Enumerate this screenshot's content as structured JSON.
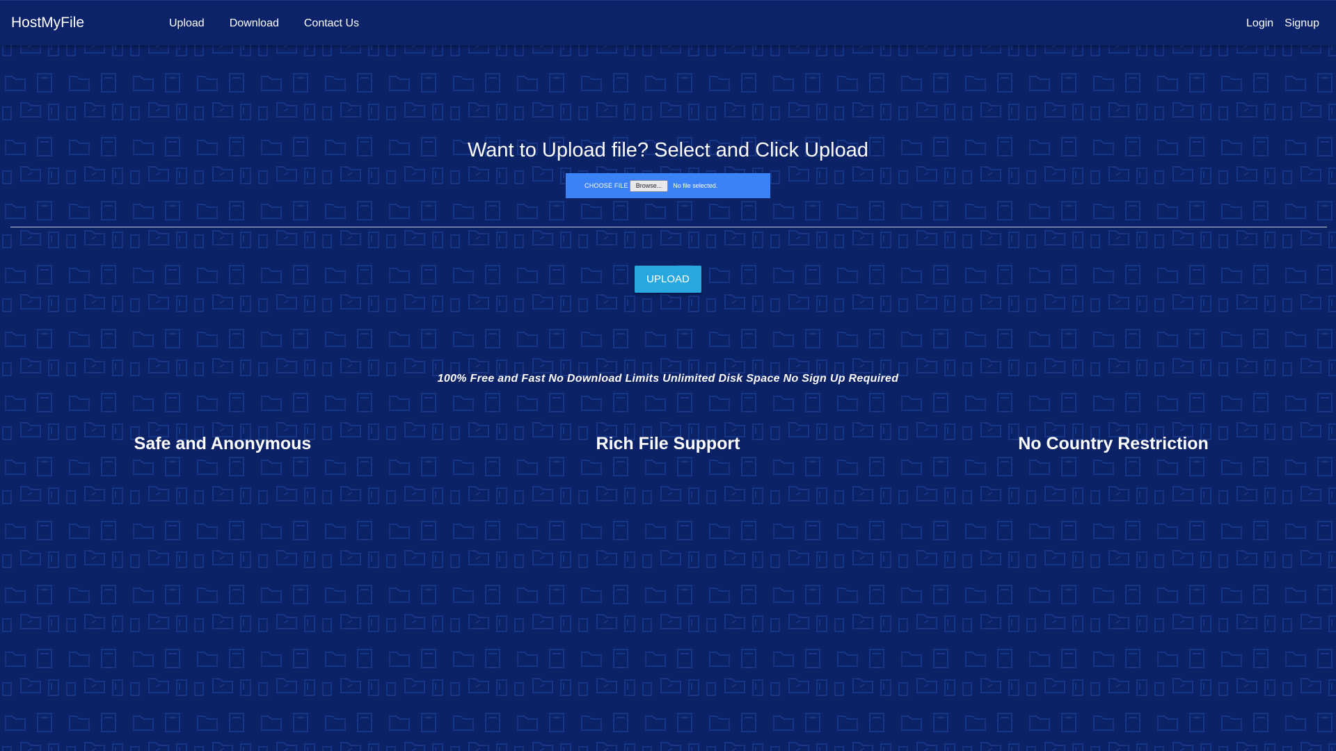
{
  "navbar": {
    "brand": "HostMyFile",
    "links": [
      {
        "label": "Upload"
      },
      {
        "label": "Download"
      },
      {
        "label": "Contact Us"
      }
    ],
    "right_links": [
      {
        "label": "Login"
      },
      {
        "label": "Signup"
      }
    ]
  },
  "hero": {
    "title": "Want to Upload file?  Select and Click Upload",
    "file_input": {
      "choose_label": "CHOOSE FILE",
      "browse_label": "Browse...",
      "status_text": "No file selected."
    },
    "upload_button": "UPLOAD"
  },
  "tagline": "100% Free and Fast No Download Limits Unlimited Disk Space No Sign Up Required",
  "features": [
    {
      "title": "Safe and Anonymous"
    },
    {
      "title": "Rich File Support"
    },
    {
      "title": "No Country Restriction"
    }
  ],
  "colors": {
    "background": "#0c2266",
    "file_box": "#3b82f6",
    "upload_button": "#29a8e0"
  }
}
